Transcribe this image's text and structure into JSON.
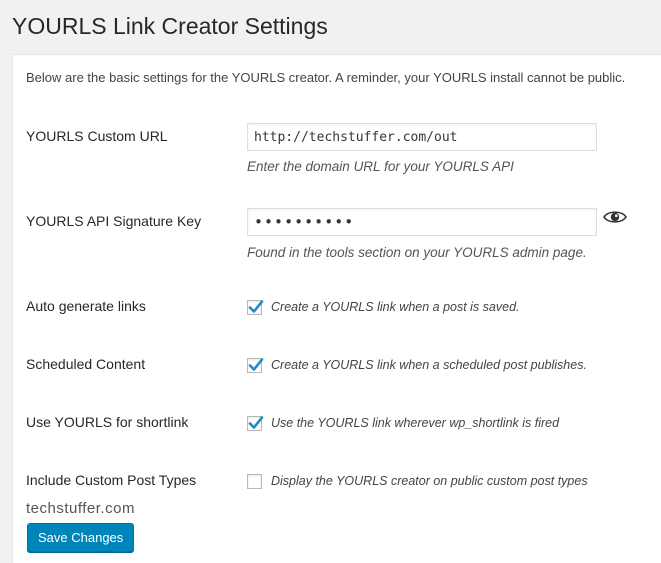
{
  "page": {
    "title": "YOURLS Link Creator Settings",
    "intro": "Below are the basic settings for the YOURLS creator. A reminder, your YOURLS install cannot be public."
  },
  "fields": {
    "custom_url": {
      "label": "YOURLS Custom URL",
      "value": "http://techstuffer.com/out",
      "description": "Enter the domain URL for your YOURLS API"
    },
    "api_key": {
      "label": "YOURLS API Signature Key",
      "value": "••••••••••",
      "description": "Found in the tools section on your YOURLS admin page.",
      "toggle_icon": "eye-icon"
    },
    "auto_generate": {
      "label": "Auto generate links",
      "checked": true,
      "description": "Create a YOURLS link when a post is saved."
    },
    "scheduled": {
      "label": "Scheduled Content",
      "checked": true,
      "description": "Create a YOURLS link when a scheduled post publishes."
    },
    "shortlink": {
      "label": "Use YOURLS for shortlink",
      "checked": true,
      "description": "Use the YOURLS link wherever wp_shortlink is fired"
    },
    "custom_post_types": {
      "label": "Include Custom Post Types",
      "checked": false,
      "description": "Display the YOURLS creator on public custom post types"
    }
  },
  "watermark": "techstuffer.com",
  "actions": {
    "save_label": "Save Changes"
  },
  "colors": {
    "primary_button": "#0085ba",
    "checkmark": "#1e8cbe",
    "page_bg": "#f1f1f1",
    "panel_bg": "#ffffff"
  }
}
